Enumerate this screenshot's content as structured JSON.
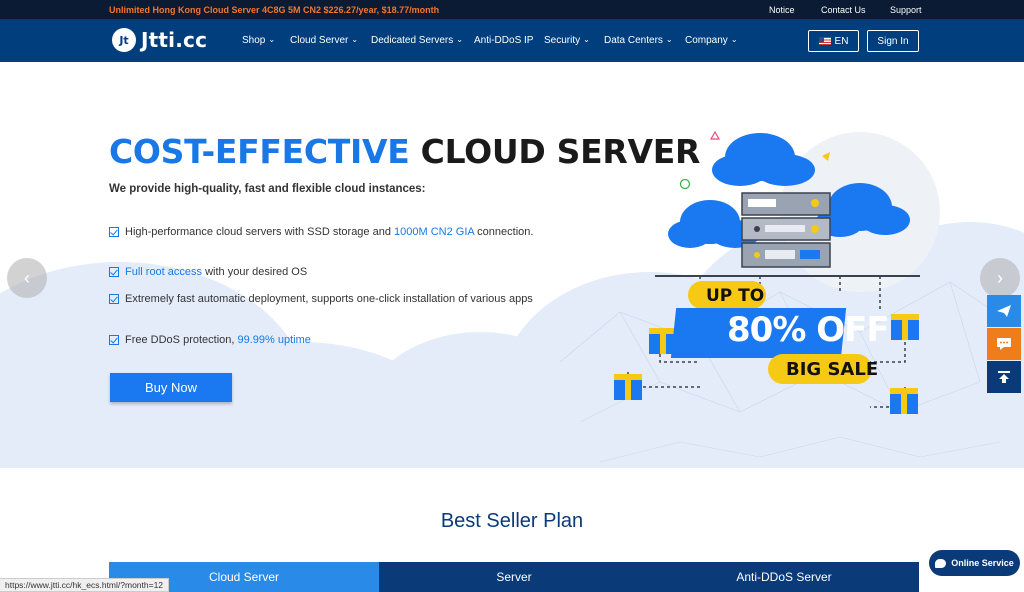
{
  "topbar": {
    "promo": "Unlimited Hong Kong Cloud Server 4C8G 5M CN2 $226.27/year, $18.77/month",
    "links": [
      "Notice",
      "Contact Us",
      "Support"
    ]
  },
  "nav": {
    "logo_mark": "Jt",
    "logo_text": "Jtti.cc",
    "menu": [
      "Shop",
      "Cloud Server",
      "Dedicated Servers",
      "Anti-DDoS IP",
      "Security",
      "Data Centers",
      "Company"
    ],
    "language": "EN",
    "signin": "Sign In"
  },
  "hero": {
    "title_accent": "COST-EFFECTIVE",
    "title_dark": "CLOUD SERVER",
    "subtitle": "We provide high-quality, fast and flexible cloud instances:",
    "features": [
      {
        "before": "High-performance cloud servers with SSD storage and ",
        "highlight": "1000M CN2 GIA",
        "after": " connection."
      },
      {
        "before": "",
        "highlight": "Full root access",
        "after": " with your desired OS"
      },
      {
        "before": "Extremely fast automatic deployment, supports one-click installation of various apps",
        "highlight": "",
        "after": ""
      },
      {
        "before": "Free DDoS protection, ",
        "highlight": "99.99% uptime",
        "after": ""
      }
    ],
    "buy_button": "Buy Now",
    "promo_graphic": {
      "up_to": "UP TO",
      "discount": "80% OFF",
      "sale": "BIG SALE"
    }
  },
  "best_seller": {
    "title": "Best Seller Plan",
    "tabs": [
      "Cloud Server",
      "Server",
      "Anti-DDoS Server"
    ],
    "active_tab": "Cloud Server"
  },
  "widgets": {
    "online_service": "Online Service",
    "status_url": "https://www.jtti.cc/hk_ecs.html/?month=12"
  },
  "colors": {
    "topbar": "#0b1b34",
    "nav": "#003e7e",
    "accent": "#1a78e6",
    "promo_orange": "#f2762e",
    "sale_yellow": "#f6c915"
  }
}
